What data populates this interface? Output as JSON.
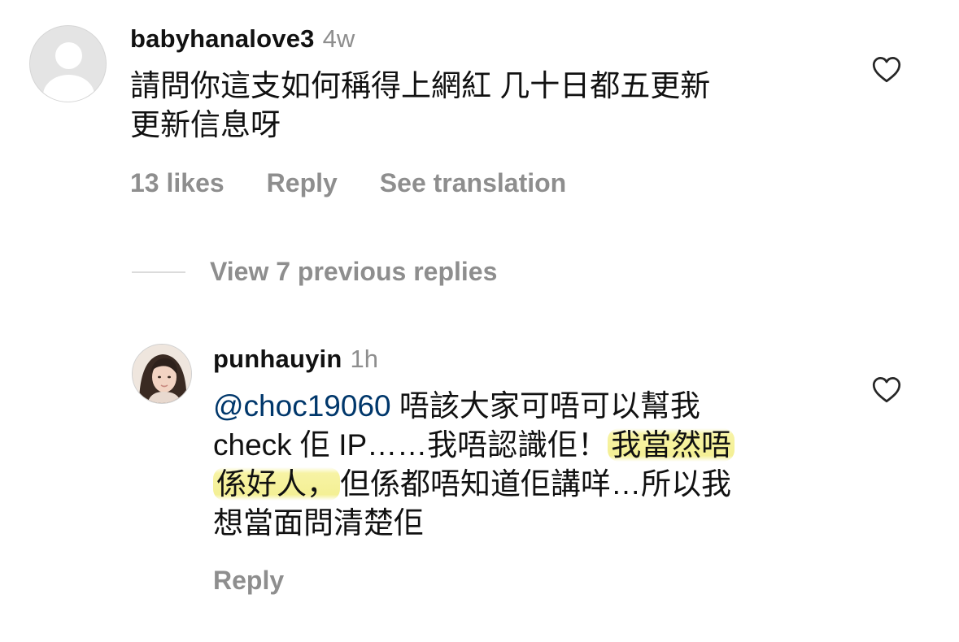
{
  "comments": [
    {
      "username": "babyhanalove3",
      "time": "4w",
      "text_line1": "請問你這支如何稱得上網紅 几十日都五更新",
      "text_line2": "更新信息呀",
      "likes": "13 likes",
      "reply_label": "Reply",
      "translation_label": "See translation"
    }
  ],
  "view_replies_label": "View 7 previous replies",
  "reply": {
    "username": "punhauyin",
    "time": "1h",
    "mention": "@choc19060",
    "line1_rest": " 唔該大家可唔可以幫我",
    "line2_plain": "check 佢 IP……我唔認識佢！",
    "line2_highlight": "我當然唔",
    "line3_highlight": "係好人，",
    "line3_plain": "但係都唔知道佢講咩…所以我",
    "line4": "想當面問清楚佢",
    "reply_label": "Reply"
  },
  "icons": {
    "like": "heart-outline-icon",
    "default_avatar": "default-avatar-icon"
  },
  "colors": {
    "secondary_text": "#8e8e8e",
    "mention": "#00376b",
    "highlight": "#f4f095"
  }
}
